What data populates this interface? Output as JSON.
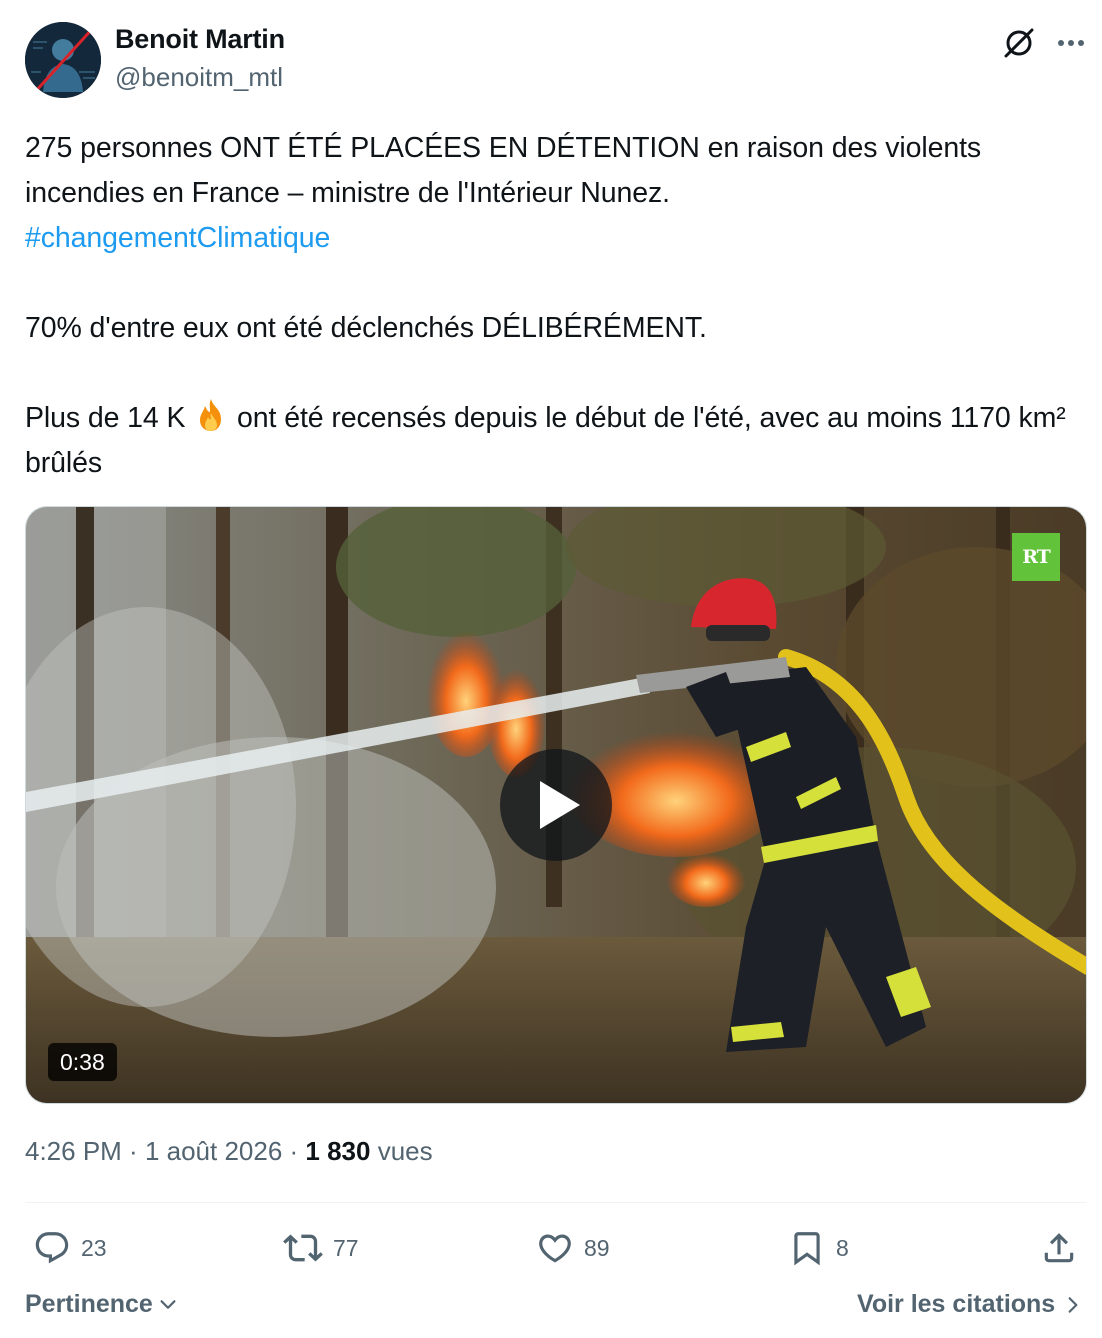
{
  "author": {
    "name": "Benoit Martin",
    "handle": "@benoitm_mtl"
  },
  "tweet": {
    "line1": "275 personnes ONT ÉTÉ PLACÉES EN DÉTENTION en raison des violents incendies en France – ministre de l'Intérieur Nunez.",
    "hashtag": "#changementClimatique",
    "line2": "70% d'entre eux ont été déclenchés DÉLIBÉRÉMENT.",
    "line3_before": "Plus de 14 K ",
    "line3_after": " ont été recensés depuis le début de l'été, avec au moins 1170 km² brûlés"
  },
  "media": {
    "duration": "0:38",
    "watermark": "RT"
  },
  "meta": {
    "time": "4:26 PM",
    "separator": " · ",
    "date": "1 août 2026",
    "views_count": "1 830",
    "views_label": " vues"
  },
  "actions": {
    "replies": "23",
    "reposts": "77",
    "likes": "89",
    "bookmarks": "8"
  },
  "footer": {
    "sort_label": "Pertinence",
    "quotes_label": "Voir les citations"
  },
  "colors": {
    "accent": "#1d9bf0",
    "secondary_text": "#536471",
    "primary_text": "#0f1419"
  },
  "icons": [
    "grok-icon",
    "more-icon",
    "fire-emoji",
    "play-icon",
    "reply-icon",
    "repost-icon",
    "like-icon",
    "bookmark-icon",
    "share-icon",
    "chevron-down-icon",
    "chevron-right-icon"
  ]
}
